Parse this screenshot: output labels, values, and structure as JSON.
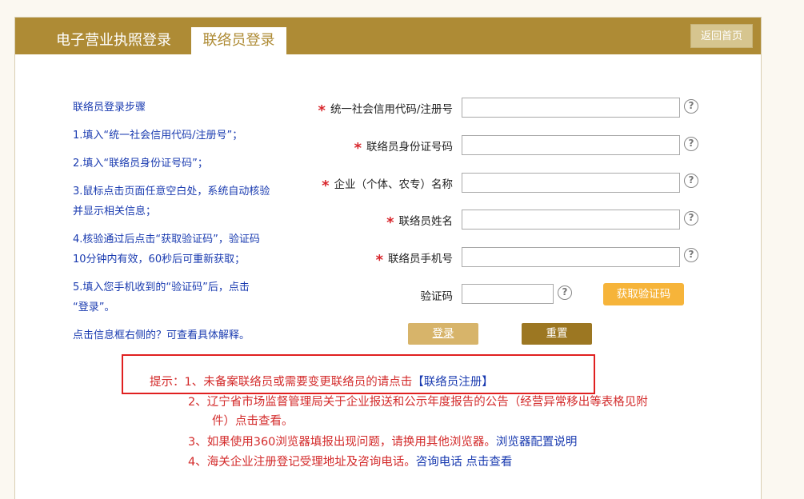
{
  "header": {
    "tab_license_login": "电子营业执照登录",
    "tab_contact_login": "联络员登录",
    "home_button": "返回首页"
  },
  "steps": {
    "title": "联络员登录步骤",
    "step1": "1.填入“统一社会信用代码/注册号”；",
    "step2": "2.填入“联络员身份证号码”；",
    "step3a": "3.鼠标点击页面任意空白处，系统自动核验",
    "step3b": "并显示相关信息；",
    "step4a": "4.核验通过后点击“获取验证码”，验证码",
    "step4b": "10分钟内有效，60秒后可重新获取；",
    "step5a": "5.填入您手机收到的“验证码”后，点击",
    "step5b": "“登录”。",
    "hint": "点击信息框右侧的？可查看具体解释。"
  },
  "form": {
    "credit_code_label": "统一社会信用代码/注册号",
    "id_number_label": "联络员身份证号码",
    "company_name_label": "企业（个体、农专）名称",
    "contact_name_label": "联络员姓名",
    "phone_label": "联络员手机号",
    "captcha_label": "验证码",
    "required_mark": "*",
    "help_symbol": "?",
    "captcha_button": "获取验证码",
    "login_button": "登录",
    "reset_button": "重置"
  },
  "notices": {
    "n1_prefix": "提示：1、未备案联络员或需要变更联络员的请点击",
    "n1_link": "【联络员注册】",
    "n2_line1": "2、辽宁省市场监督管理局关于企业报送和公示年度报告的公告（经营异常移出等表格见附",
    "n2_line2": "件）点击查看。",
    "n3_text": "3、如果使用360浏览器填报出现问题，请换用其他浏览器。",
    "n3_link": "浏览器配置说明",
    "n4_text": "4、海关企业注册登记受理地址及咨询电话。",
    "n4_link": "咨询电话 点击查看"
  },
  "colors": {
    "brand": "#ae8b35",
    "link": "#1a3bb0",
    "alert": "#d32b2b",
    "captcha_button": "#f6b43a"
  }
}
